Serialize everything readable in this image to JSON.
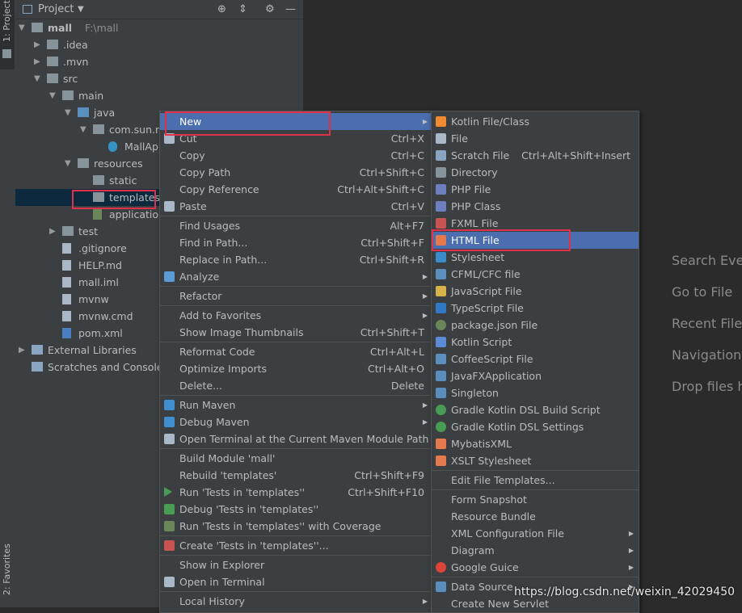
{
  "side_strip": {
    "project_tab": "1: Project",
    "favorites_tab": "2: Favorites"
  },
  "panel": {
    "title": "Project"
  },
  "tree": [
    {
      "label": "mall",
      "extra": "F:\\mall",
      "kind": "module",
      "arrow": "▼",
      "depth": 0
    },
    {
      "label": ".idea",
      "kind": "folder",
      "arrow": "▶",
      "depth": 1
    },
    {
      "label": ".mvn",
      "kind": "folder",
      "arrow": "▶",
      "depth": 1
    },
    {
      "label": "src",
      "kind": "folder",
      "arrow": "▼",
      "depth": 1
    },
    {
      "label": "main",
      "kind": "folder",
      "arrow": "▼",
      "depth": 2
    },
    {
      "label": "java",
      "kind": "folder-blue",
      "arrow": "▼",
      "depth": 3
    },
    {
      "label": "com.sun.ma",
      "kind": "package",
      "arrow": "▼",
      "depth": 4
    },
    {
      "label": "MallApp",
      "kind": "class",
      "arrow": "",
      "depth": 5
    },
    {
      "label": "resources",
      "kind": "folder",
      "arrow": "▼",
      "depth": 3
    },
    {
      "label": "static",
      "kind": "folder",
      "arrow": "",
      "depth": 4
    },
    {
      "label": "templates",
      "kind": "folder",
      "arrow": "",
      "depth": 4,
      "selected": true
    },
    {
      "label": "application.",
      "kind": "config",
      "arrow": "",
      "depth": 4
    },
    {
      "label": "test",
      "kind": "folder",
      "arrow": "▶",
      "depth": 2
    },
    {
      "label": ".gitignore",
      "kind": "file",
      "arrow": "",
      "depth": 2
    },
    {
      "label": "HELP.md",
      "kind": "file",
      "arrow": "",
      "depth": 2
    },
    {
      "label": "mall.iml",
      "kind": "file",
      "arrow": "",
      "depth": 2
    },
    {
      "label": "mvnw",
      "kind": "file",
      "arrow": "",
      "depth": 2
    },
    {
      "label": "mvnw.cmd",
      "kind": "file",
      "arrow": "",
      "depth": 2
    },
    {
      "label": "pom.xml",
      "kind": "maven",
      "arrow": "",
      "depth": 2
    },
    {
      "label": "External Libraries",
      "kind": "libs",
      "arrow": "▶",
      "depth": 0
    },
    {
      "label": "Scratches and Consoles",
      "kind": "scratch",
      "arrow": "",
      "depth": 0
    }
  ],
  "welcome": [
    "Search Ever",
    "Go to File",
    "Recent Files",
    "Navigation",
    "Drop files h"
  ],
  "context_menu": [
    {
      "label": "New",
      "shortcut": "",
      "sub": true,
      "hl": true,
      "icon": ""
    },
    {
      "label": "Cut",
      "shortcut": "Ctrl+X",
      "icon": "cut"
    },
    {
      "label": "Copy",
      "shortcut": "Ctrl+C",
      "icon": ""
    },
    {
      "label": "Copy Path",
      "shortcut": "Ctrl+Shift+C",
      "icon": ""
    },
    {
      "label": "Copy Reference",
      "shortcut": "Ctrl+Alt+Shift+C",
      "icon": ""
    },
    {
      "label": "Paste",
      "shortcut": "Ctrl+V",
      "icon": "paste"
    },
    {
      "sep": true
    },
    {
      "label": "Find Usages",
      "shortcut": "Alt+F7",
      "icon": ""
    },
    {
      "label": "Find in Path...",
      "shortcut": "Ctrl+Shift+F",
      "icon": ""
    },
    {
      "label": "Replace in Path...",
      "shortcut": "Ctrl+Shift+R",
      "icon": ""
    },
    {
      "label": "Analyze",
      "shortcut": "",
      "sub": true,
      "icon": "analyze"
    },
    {
      "sep": true
    },
    {
      "label": "Refactor",
      "shortcut": "",
      "sub": true,
      "icon": ""
    },
    {
      "sep": true
    },
    {
      "label": "Add to Favorites",
      "shortcut": "",
      "sub": true,
      "icon": ""
    },
    {
      "label": "Show Image Thumbnails",
      "shortcut": "Ctrl+Shift+T",
      "icon": ""
    },
    {
      "sep": true
    },
    {
      "label": "Reformat Code",
      "shortcut": "Ctrl+Alt+L",
      "icon": ""
    },
    {
      "label": "Optimize Imports",
      "shortcut": "Ctrl+Alt+O",
      "icon": ""
    },
    {
      "label": "Delete...",
      "shortcut": "Delete",
      "icon": ""
    },
    {
      "sep": true
    },
    {
      "label": "Run Maven",
      "shortcut": "",
      "sub": true,
      "icon": "maven"
    },
    {
      "label": "Debug Maven",
      "shortcut": "",
      "sub": true,
      "icon": "maven"
    },
    {
      "label": "Open Terminal at the Current Maven Module Path",
      "shortcut": "",
      "icon": "terminal"
    },
    {
      "sep": true
    },
    {
      "label": "Build Module 'mall'",
      "shortcut": "",
      "icon": ""
    },
    {
      "label": "Rebuild 'templates'",
      "shortcut": "Ctrl+Shift+F9",
      "icon": ""
    },
    {
      "label": "Run 'Tests in 'templates''",
      "shortcut": "Ctrl+Shift+F10",
      "icon": "run"
    },
    {
      "label": "Debug 'Tests in 'templates''",
      "shortcut": "",
      "icon": "debug"
    },
    {
      "label": "Run 'Tests in 'templates'' with Coverage",
      "shortcut": "",
      "icon": "coverage"
    },
    {
      "sep": true
    },
    {
      "label": "Create 'Tests in 'templates''...",
      "shortcut": "",
      "icon": "create"
    },
    {
      "sep": true
    },
    {
      "label": "Show in Explorer",
      "shortcut": "",
      "icon": ""
    },
    {
      "label": "Open in Terminal",
      "shortcut": "",
      "icon": "terminal"
    },
    {
      "sep": true
    },
    {
      "label": "Local History",
      "shortcut": "",
      "sub": true,
      "icon": ""
    }
  ],
  "new_menu": [
    {
      "label": "Kotlin File/Class",
      "shortcut": "",
      "icon": "kotlin"
    },
    {
      "label": "File",
      "shortcut": "",
      "icon": "file"
    },
    {
      "label": "Scratch File",
      "shortcut": "Ctrl+Alt+Shift+Insert",
      "icon": "scratch"
    },
    {
      "label": "Directory",
      "shortcut": "",
      "icon": "folder"
    },
    {
      "label": "PHP File",
      "shortcut": "",
      "icon": "php"
    },
    {
      "label": "PHP Class",
      "shortcut": "",
      "icon": "php"
    },
    {
      "label": "FXML File",
      "shortcut": "",
      "icon": "fxml"
    },
    {
      "label": "HTML File",
      "shortcut": "",
      "icon": "html",
      "hl": true
    },
    {
      "label": "Stylesheet",
      "shortcut": "",
      "icon": "css"
    },
    {
      "label": "CFML/CFC file",
      "shortcut": "",
      "icon": "cf"
    },
    {
      "label": "JavaScript File",
      "shortcut": "",
      "icon": "js"
    },
    {
      "label": "TypeScript File",
      "shortcut": "",
      "icon": "ts"
    },
    {
      "label": "package.json File",
      "shortcut": "",
      "icon": "npm"
    },
    {
      "label": "Kotlin Script",
      "shortcut": "",
      "icon": "kts"
    },
    {
      "label": "CoffeeScript File",
      "shortcut": "",
      "icon": "coffee"
    },
    {
      "label": "JavaFXApplication",
      "shortcut": "",
      "icon": "javafx"
    },
    {
      "label": "Singleton",
      "shortcut": "",
      "icon": "singleton"
    },
    {
      "label": "Gradle Kotlin DSL Build Script",
      "shortcut": "",
      "icon": "gradle"
    },
    {
      "label": "Gradle Kotlin DSL Settings",
      "shortcut": "",
      "icon": "gradle"
    },
    {
      "label": "MybatisXML",
      "shortcut": "",
      "icon": "xml"
    },
    {
      "label": "XSLT Stylesheet",
      "shortcut": "",
      "icon": "xsl"
    },
    {
      "sep": true
    },
    {
      "label": "Edit File Templates...",
      "shortcut": "",
      "icon": ""
    },
    {
      "sep": true
    },
    {
      "label": "Form Snapshot",
      "shortcut": "",
      "icon": ""
    },
    {
      "label": "Resource Bundle",
      "shortcut": "",
      "icon": ""
    },
    {
      "label": "XML Configuration File",
      "shortcut": "",
      "sub": true,
      "icon": ""
    },
    {
      "label": "Diagram",
      "shortcut": "",
      "sub": true,
      "icon": ""
    },
    {
      "label": "Google Guice",
      "shortcut": "",
      "sub": true,
      "icon": "google"
    },
    {
      "sep": true
    },
    {
      "label": "Data Source",
      "shortcut": "",
      "sub": true,
      "icon": "db"
    },
    {
      "label": "Create New Servlet",
      "shortcut": "",
      "icon": ""
    }
  ],
  "watermark": "https://blog.csdn.net/weixin_42029450",
  "colors": {
    "highlight": "#4b6eaf",
    "redbox": "#e0304a",
    "panel_bg": "#3c3f41",
    "editor_bg": "#2b2b2b"
  }
}
